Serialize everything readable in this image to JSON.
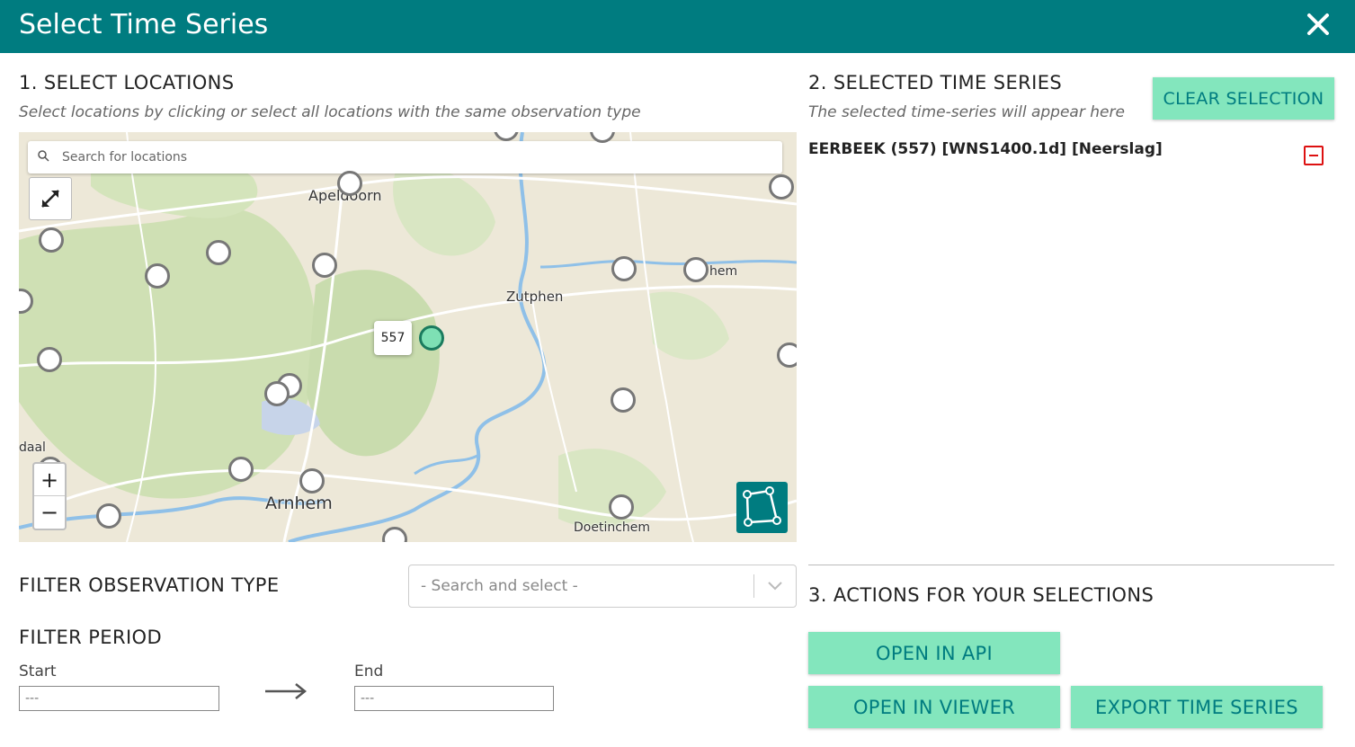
{
  "header": {
    "title": "Select Time Series"
  },
  "section1": {
    "title": "1. SELECT LOCATIONS",
    "subtitle": "Select locations by clicking or select all locations with the same observation type"
  },
  "map": {
    "search_placeholder": "Search for locations",
    "tooltip": "557",
    "places": [
      "Apeldoorn",
      "Zutphen",
      "Arnhem",
      "Doetinchem",
      "hem",
      "daal"
    ],
    "zoom_in": "+",
    "zoom_out": "−"
  },
  "filters": {
    "observation_label": "FILTER OBSERVATION TYPE",
    "observation_placeholder": "- Search and select -",
    "period_label": "FILTER PERIOD",
    "start_label": "Start",
    "end_label": "End",
    "start_placeholder": "---",
    "end_placeholder": "---"
  },
  "section2": {
    "title": "2. SELECTED TIME SERIES",
    "subtitle": "The selected time-series will appear here",
    "clear_label": "CLEAR SELECTION",
    "items": [
      "EERBEEK (557) [WNS1400.1d] [Neerslag]"
    ]
  },
  "section3": {
    "title": "3. ACTIONS FOR YOUR SELECTIONS",
    "open_api": "OPEN IN API",
    "open_viewer": "OPEN IN VIEWER",
    "export": "EXPORT TIME SERIES"
  },
  "colors": {
    "header": "#007c80",
    "button": "#83e6bd",
    "button_text": "#007c80",
    "selected_marker": "#7ee0b4",
    "remove": "#dd1111"
  }
}
